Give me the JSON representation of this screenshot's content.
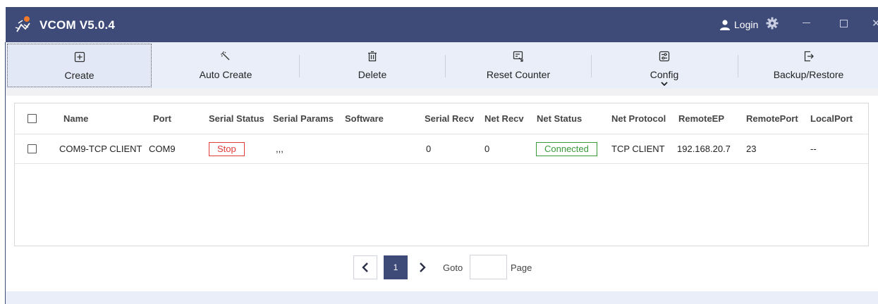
{
  "window": {
    "title": "VCOM V5.0.4",
    "login_label": "Login",
    "close_glyph": "✕"
  },
  "toolbar": {
    "items": [
      {
        "label": "Create",
        "icon": "plus-square-icon"
      },
      {
        "label": "Auto Create",
        "icon": "magic-wand-icon"
      },
      {
        "label": "Delete",
        "icon": "trash-icon"
      },
      {
        "label": "Reset Counter",
        "icon": "reset-counter-icon"
      },
      {
        "label": "Config",
        "icon": "config-sliders-icon"
      },
      {
        "label": "Backup/Restore",
        "icon": "backup-restore-icon"
      }
    ]
  },
  "table": {
    "columns": [
      "Name",
      "Port",
      "Serial Status",
      "Serial Params",
      "Software",
      "Serial Recv",
      "Net Recv",
      "Net Status",
      "Net Protocol",
      "RemoteEP",
      "RemotePort",
      "LocalPort"
    ],
    "rows": [
      {
        "name": "COM9-TCP CLIENT",
        "port": "COM9",
        "serial_status": "Stop",
        "serial_params": ",,,",
        "software": "",
        "serial_recv": "0",
        "net_recv": "0",
        "net_status": "Connected",
        "net_protocol": "TCP CLIENT",
        "remote_ep": "192.168.20.7",
        "remote_port": "23",
        "local_port": "--"
      }
    ]
  },
  "pagination": {
    "current_page": "1",
    "goto_label": "Goto",
    "page_label": "Page",
    "goto_value": ""
  },
  "colors": {
    "title_bar": "#3e4a78",
    "toolbar_bg": "#e9eef9",
    "stop": "#e23b3b",
    "connected": "#3a9a3a"
  }
}
